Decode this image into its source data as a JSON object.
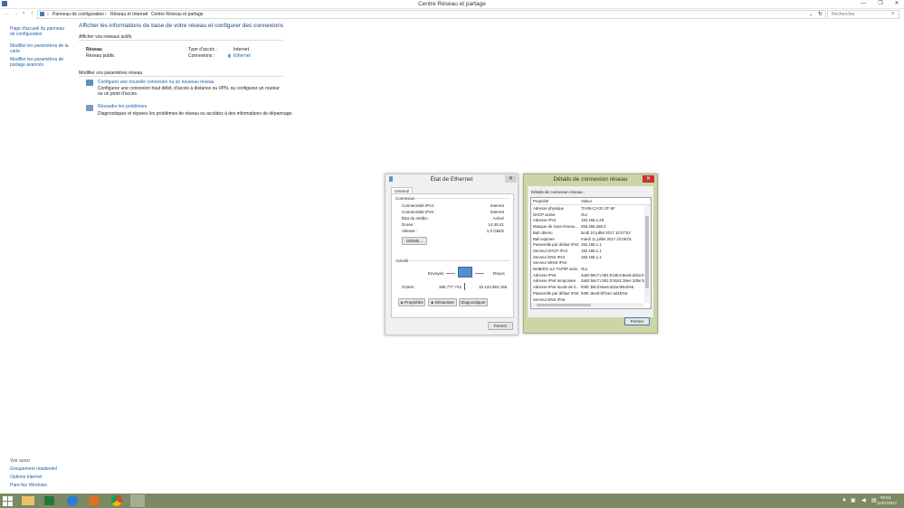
{
  "window": {
    "title": "Centre Réseau et partage",
    "buttons": [
      "—",
      "❐",
      "✕"
    ]
  },
  "address": {
    "crumbs": [
      "Panneau de configuration",
      "Réseau et Internet",
      "Centre Réseau et partage"
    ],
    "search_placeholder": "Rechercher"
  },
  "sidebar": {
    "items": [
      "Page d'accueil du panneau de configuration",
      "Modifier les paramètres de la carte",
      "Modifier les paramètres de partage avancés"
    ],
    "see_also_title": "Voir aussi",
    "see_also": [
      "Groupement résidentiel",
      "Options Internet",
      "Pare-feu Windows"
    ]
  },
  "main": {
    "heading": "Afficher les informations de base de votre réseau et configurer des connexions",
    "active_networks": "Afficher vos réseaux actifs",
    "network_name": "Réseau",
    "network_type": "Réseau public",
    "access_type_label": "Type d'accès :",
    "access_type_value": "Internet",
    "connections_label": "Connexions :",
    "connections_value": "Ethernet",
    "modify_title": "Modifier vos paramètres réseau",
    "task1_link": "Configurer une nouvelle connexion ou un nouveau réseau",
    "task1_desc": "Configurez une connexion haut débit, d'accès à distance ou VPN, ou configurez un routeur ou un point d'accès.",
    "task2_link": "Résoudre les problèmes",
    "task2_desc": "Diagnostiquez et réparez les problèmes de réseau ou accédez à des informations de dépannage."
  },
  "ethernet": {
    "title": "État de Ethernet",
    "tab": "Général",
    "connection_title": "Connexion",
    "rows": [
      {
        "label": "Connectivité IPv4 :",
        "value": "Internet"
      },
      {
        "label": "Connectivité IPv6 :",
        "value": "Internet"
      },
      {
        "label": "État du média :",
        "value": "Activé"
      },
      {
        "label": "Durée :",
        "value": "14:45:41"
      },
      {
        "label": "Vitesse :",
        "value": "1,0 Gbit/s"
      }
    ],
    "details_button": "Détails...",
    "activity_title": "Activité",
    "sent_label": "Envoyés",
    "received_label": "Reçus",
    "octets_label": "Octets :",
    "octets_sent": "385 777 743",
    "octets_received": "15 123 863 166",
    "properties_button": "Propriétés",
    "disable_button": "Désactiver",
    "diagnose_button": "Diagnostiquer",
    "close_button": "Fermer"
  },
  "details": {
    "title": "Détails de connexion réseau",
    "subtitle": "Détails de connexion réseau :",
    "col_property": "Propriété",
    "col_value": "Valeur",
    "rows": [
      {
        "p": "Adresse physique",
        "v": "70-85-C2-0C-2F-5F"
      },
      {
        "p": "DHCP activé",
        "v": "Oui"
      },
      {
        "p": "Adresse IPv4",
        "v": "192.168.1.29"
      },
      {
        "p": "Masque de sous-réseau...",
        "v": "255.255.255.0"
      },
      {
        "p": "Bail obtenu",
        "v": "lundi 10 juillet 2017 10:07:52"
      },
      {
        "p": "Bail expirant",
        "v": "mardi 11 juillet 2017 22:08:01"
      },
      {
        "p": "Passerelle par défaut IPv4",
        "v": "192.168.1.1"
      },
      {
        "p": "Serveur DHCP IPv4",
        "v": "192.168.1.1"
      },
      {
        "p": "Serveur DNS IPv4",
        "v": "192.168.1.1"
      },
      {
        "p": "Serveur WINS IPv4",
        "v": ""
      },
      {
        "p": "NetBIOS sur TCP/IP activ...",
        "v": "Oui"
      },
      {
        "p": "Adresse IPv6",
        "v": "2a02:56c7:c381:0:b8c3:8ee6:dcba:9"
      },
      {
        "p": "Adresse IPv6 temporaire",
        "v": "2a02:56c7:c381:0:9151:35ee:10be:b"
      },
      {
        "p": "Adresse IPv6 locale de li...",
        "v": "fe80::b8c3:8ee6:dcba:90ed%5"
      },
      {
        "p": "Passerelle par défaut IPv6",
        "v": "fe80::dee8:9f:feec:ad1b%5"
      },
      {
        "p": "Serveur DNS IPv6",
        "v": ""
      }
    ],
    "close_button": "Fermer"
  },
  "taskbar": {
    "time": "06:53",
    "date": "11/07/2017"
  }
}
